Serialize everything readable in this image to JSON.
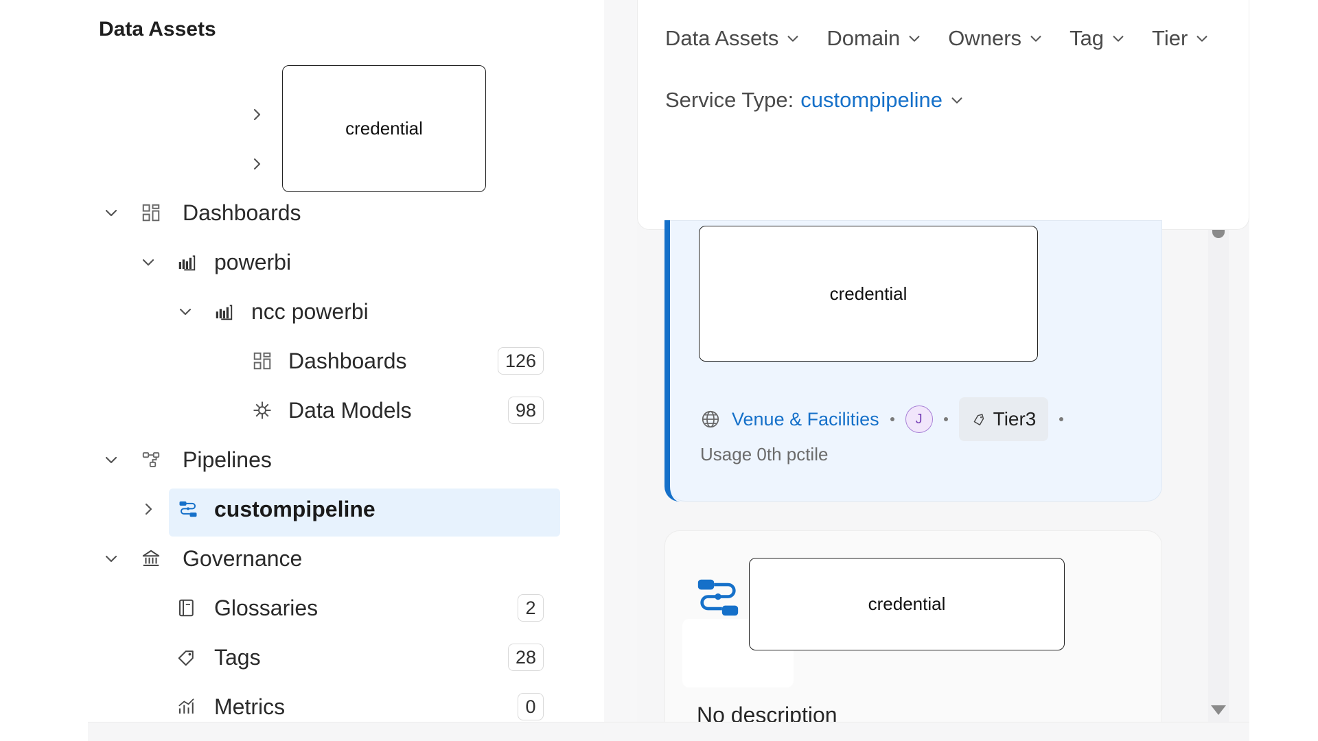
{
  "sidebar": {
    "title": "Data Assets",
    "tree": [
      {
        "id": "dashboards",
        "label": "Dashboards",
        "icon": "dashboard-icon",
        "expanded": true
      },
      {
        "id": "powerbi",
        "label": "powerbi",
        "icon": "powerbi-icon",
        "expanded": true
      },
      {
        "id": "ncc-powerbi",
        "label": "ncc powerbi",
        "icon": "powerbi-icon",
        "expanded": true
      },
      {
        "id": "ncc-dashboards",
        "label": "Dashboards",
        "icon": "dashboard-icon",
        "count": "126"
      },
      {
        "id": "data-models",
        "label": "Data Models",
        "icon": "data-model-icon",
        "count": "98"
      },
      {
        "id": "pipelines",
        "label": "Pipelines",
        "icon": "pipeline-icon",
        "expanded": true
      },
      {
        "id": "custompipeline",
        "label": "custompipeline",
        "icon": "custom-pipeline-icon",
        "expanded": false,
        "selected": true
      },
      {
        "id": "governance",
        "label": "Governance",
        "icon": "governance-icon",
        "expanded": true
      },
      {
        "id": "glossaries",
        "label": "Glossaries",
        "icon": "glossary-icon",
        "count": "2"
      },
      {
        "id": "tags",
        "label": "Tags",
        "icon": "tag-icon",
        "count": "28"
      },
      {
        "id": "metrics",
        "label": "Metrics",
        "icon": "metrics-icon",
        "count": "0"
      }
    ],
    "overlay_label": "credential"
  },
  "filters": {
    "items": [
      "Data Assets",
      "Domain",
      "Owners",
      "Tag",
      "Tier"
    ],
    "service_type_label": "Service Type:",
    "service_type_value": "custompipeline"
  },
  "results": {
    "card1": {
      "overlay_label": "credential",
      "domain": "Venue & Facilities",
      "owner_initial": "J",
      "tier": "Tier3",
      "usage": "Usage 0th pctile"
    },
    "card2": {
      "overlay_label": "credential",
      "description": "No description"
    }
  },
  "colors": {
    "accent": "#1570c9",
    "selected_bg": "#e7f2fd",
    "card_bg": "#eef5fe"
  }
}
